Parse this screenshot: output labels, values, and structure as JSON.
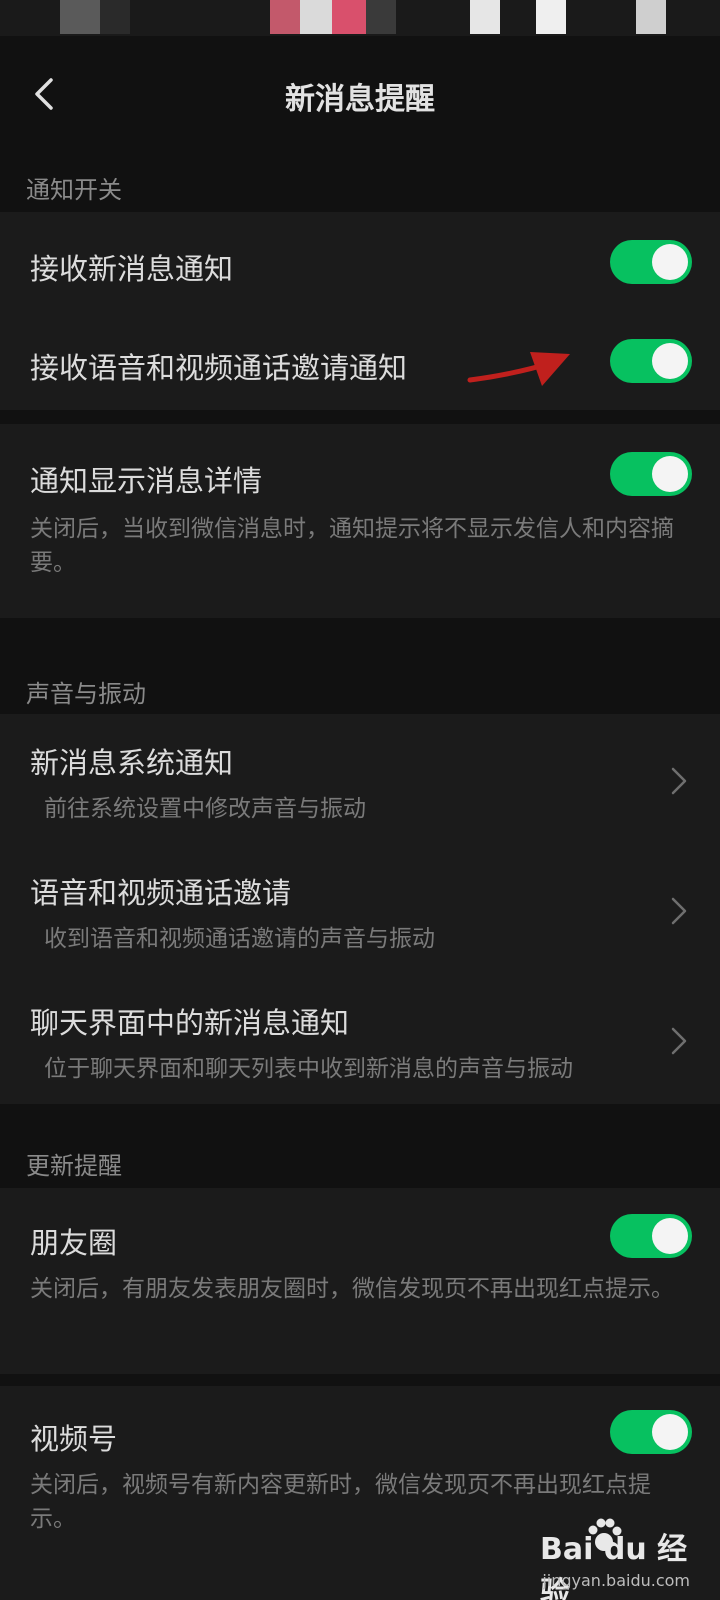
{
  "header": {
    "title": "新消息提醒"
  },
  "sections": {
    "notify": {
      "label": "通知开关",
      "receive_messages": {
        "title": "接收新消息通知",
        "enabled": true
      },
      "receive_calls": {
        "title": "接收语音和视频通话邀请通知",
        "enabled": true
      },
      "show_details": {
        "title": "通知显示消息详情",
        "description": "关闭后，当收到微信消息时，通知提示将不显示发信人和内容摘要。",
        "enabled": true
      }
    },
    "sound": {
      "label": "声音与振动",
      "items": [
        {
          "title": "新消息系统通知",
          "description": "前往系统设置中修改声音与振动"
        },
        {
          "title": "语音和视频通话邀请",
          "description": "收到语音和视频通话邀请的声音与振动"
        },
        {
          "title": "聊天界面中的新消息通知",
          "description": "位于聊天界面和聊天列表中收到新消息的声音与振动"
        }
      ]
    },
    "updates": {
      "label": "更新提醒",
      "moments": {
        "title": "朋友圈",
        "description": "关闭后，有朋友发表朋友圈时，微信发现页不再出现红点提示。",
        "enabled": true
      },
      "channels": {
        "title": "视频号",
        "description": "关闭后，视频号有新内容更新时，微信发现页不再出现红点提示。",
        "enabled": true
      }
    }
  },
  "watermark": {
    "logo": "Bai du 经验",
    "url": "jingyan.baidu.com"
  },
  "colors": {
    "toggle_on": "#07c160",
    "background": "#111111",
    "card": "#1b1b1b",
    "annotation_arrow": "#c0201d"
  },
  "icons": [
    "back-arrow-icon",
    "chevron-right-icon",
    "red-annotation-arrow-icon",
    "baidu-paw-icon"
  ]
}
